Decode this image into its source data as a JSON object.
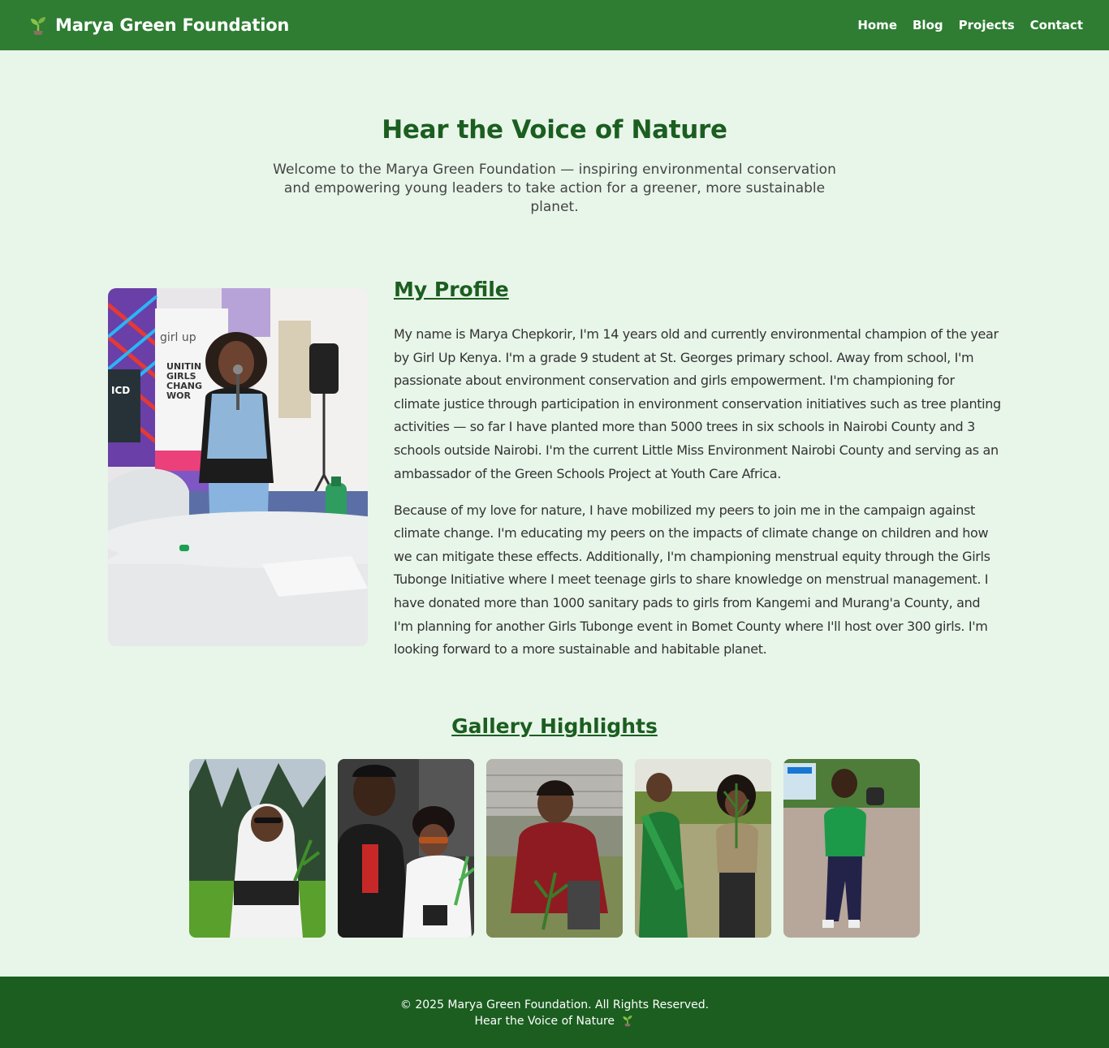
{
  "header": {
    "brand_icon": "seedling-icon",
    "brand_title": "Marya Green Foundation",
    "nav": [
      {
        "label": "Home"
      },
      {
        "label": "Blog"
      },
      {
        "label": "Projects"
      },
      {
        "label": "Contact"
      }
    ],
    "background_color": "#2e7d32"
  },
  "hero": {
    "title": "Hear the Voice of Nature",
    "subtitle": "Welcome to the Marya Green Foundation — inspiring environmental conservation and empowering young leaders to take action for a greener, more sustainable planet."
  },
  "profile": {
    "heading": "My Profile",
    "paragraphs": [
      "My name is Marya Chepkorir, I'm 14 years old and currently environmental champion of the year by Girl Up Kenya. I'm a grade 9 student at St. Georges primary school. Away from school, I'm passionate about environment conservation and girls empowerment. I'm championing for climate justice through participation in environment conservation initiatives such as tree planting activities — so far I have planted more than 5000 trees in six schools in Nairobi County and 3 schools outside Nairobi. I'm the current Little Miss Environment Nairobi County and serving as an ambassador of the Green Schools Project at Youth Care Africa.",
      "Because of my love for nature, I have mobilized my peers to join me in the campaign against climate change. I'm educating my peers on the impacts of climate change on children and how we can mitigate these effects. Additionally, I'm championing menstrual equity through the Girls Tubonge Initiative where I meet teenage girls to share knowledge on menstrual management. I have donated more than 1000 sanitary pads to girls from Kangemi and Murang'a County, and I'm planning for another Girls Tubonge event in Bomet County where I'll host over 300 girls. I'm looking forward to a more sustainable and habitable planet."
    ],
    "banner_text": "UNITING GIRLS TO CHANGE THE WORLD",
    "banner_brand": "girl up"
  },
  "gallery": {
    "heading": "Gallery Highlights",
    "items": [
      {
        "name": "gallery-photo-1"
      },
      {
        "name": "gallery-photo-2"
      },
      {
        "name": "gallery-photo-3"
      },
      {
        "name": "gallery-photo-4"
      },
      {
        "name": "gallery-photo-5"
      }
    ]
  },
  "footer": {
    "copyright": "© 2025 Marya Green Foundation. All Rights Reserved.",
    "tagline": "Hear the Voice of Nature",
    "tagline_icon": "seedling-icon",
    "background_color": "#1b5e20"
  },
  "colors": {
    "page_background": "#e8f5e9",
    "heading_green": "#1b5e20",
    "header_green": "#2e7d32"
  }
}
